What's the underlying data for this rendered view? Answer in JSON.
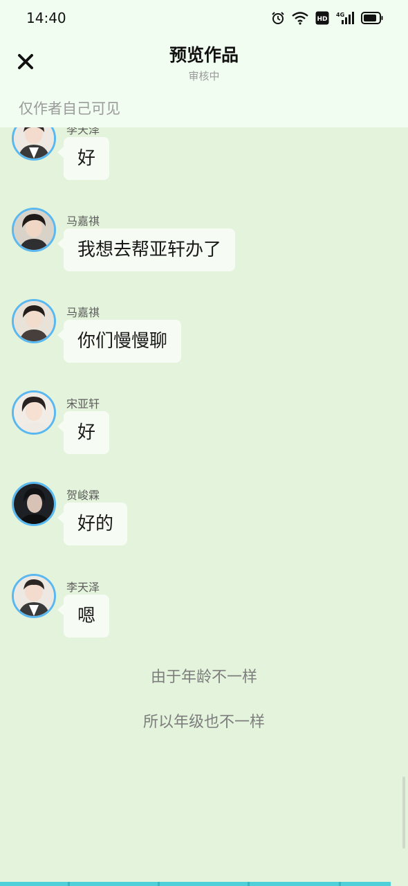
{
  "status_bar": {
    "time": "14:40",
    "icons": [
      "alarm-icon",
      "wifi-icon",
      "hd-icon",
      "4g-signal-icon",
      "battery-icon"
    ],
    "network_label": "4G",
    "hd_label": "HD"
  },
  "header": {
    "close_icon": "close-icon",
    "title": "预览作品",
    "subtitle": "审核中",
    "visibility": "仅作者自己可见"
  },
  "messages": [
    {
      "sender": "李天泽",
      "text": "好"
    },
    {
      "sender": "马嘉祺",
      "text": "我想去帮亚轩办了"
    },
    {
      "sender": "马嘉祺",
      "text": "你们慢慢聊"
    },
    {
      "sender": "宋亚轩",
      "text": "好"
    },
    {
      "sender": "贺峻霖",
      "text": "好的"
    },
    {
      "sender": "李天泽",
      "text": "嗯"
    }
  ],
  "narrations": [
    "由于年龄不一样",
    "所以年级也不一样"
  ],
  "colors": {
    "background": "#e4f3dc",
    "header_bg": "#f2fdf2",
    "bubble_bg": "#f6fcf3",
    "avatar_ring": "#5ab8f0",
    "bottom_strip": "#4fcfd8"
  }
}
